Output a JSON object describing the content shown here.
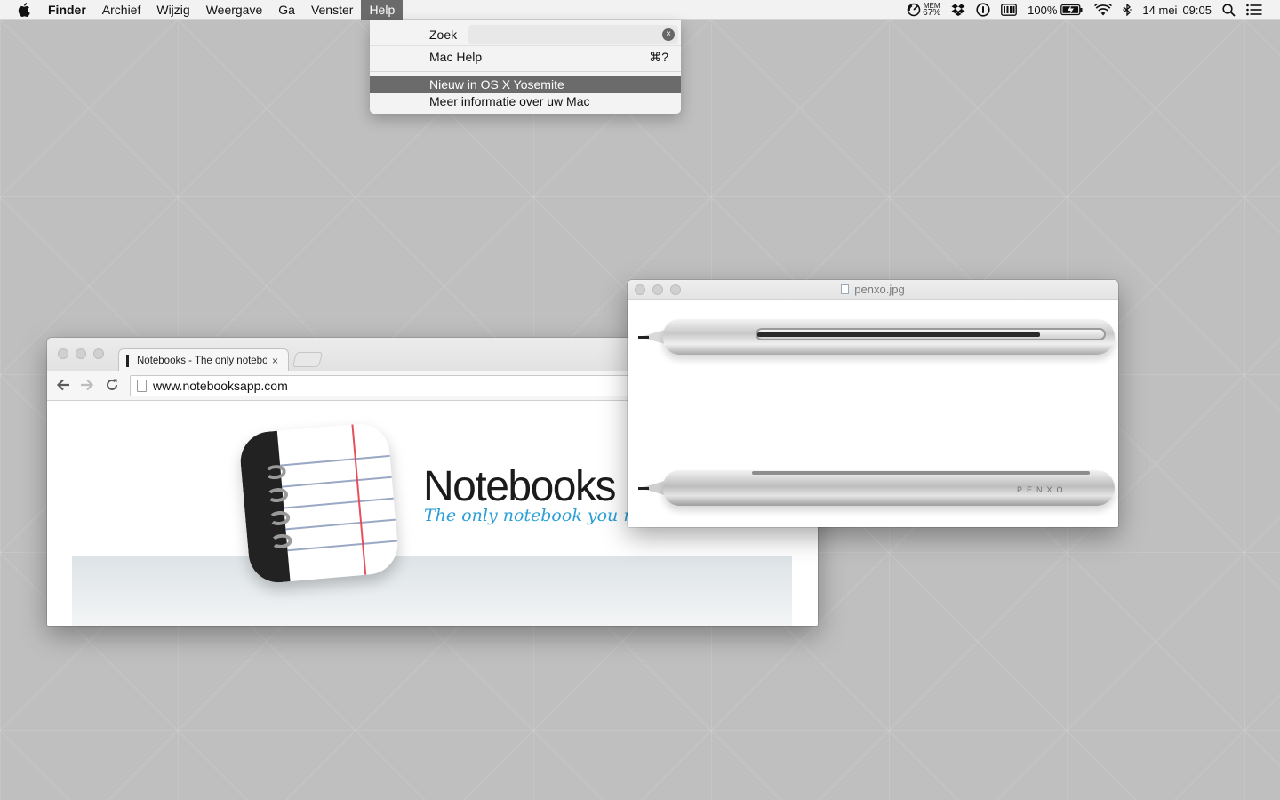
{
  "menubar": {
    "app_name": "Finder",
    "menus": [
      "Archief",
      "Wijzig",
      "Weergave",
      "Ga",
      "Venster",
      "Help"
    ],
    "active_menu": "Help",
    "status": {
      "mem_label": "MEM",
      "mem_value": "67%",
      "battery_percent": "100%",
      "date": "14 mei",
      "time": "09:05"
    }
  },
  "help_menu": {
    "search_label": "Zoek",
    "items": [
      {
        "label": "Mac Help",
        "shortcut": "⌘?"
      },
      {
        "label": "Nieuw in OS X Yosemite",
        "highlighted": true
      },
      {
        "label": "Meer informatie over uw Mac"
      }
    ]
  },
  "browser": {
    "tab_title": "Notebooks - The only notebook you need.",
    "tab_close": "×",
    "url": "www.notebooksapp.com",
    "page": {
      "brand": "Notebooks",
      "tagline": "The only notebook you need."
    }
  },
  "preview": {
    "title": "penxo.jpg",
    "product_mark": "PENXO"
  },
  "colors": {
    "menu_highlight": "#6b6b6b",
    "desktop": "#bfbfbf",
    "tagline_blue": "#2a9fd6"
  }
}
